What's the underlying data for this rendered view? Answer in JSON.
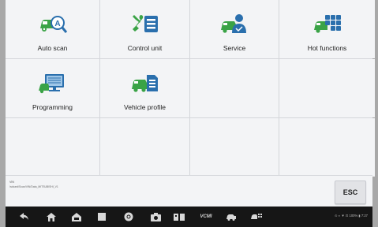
{
  "tiles": [
    {
      "label": "Auto scan"
    },
    {
      "label": "Control unit"
    },
    {
      "label": "Service"
    },
    {
      "label": "Hot functions"
    },
    {
      "label": "Programming"
    },
    {
      "label": "Vehicle profile"
    }
  ],
  "footer": {
    "vin_label": "VIN",
    "vin_path": "/sdcard/Scan/VIN/Data_MITSUBISHI_V1",
    "esc_label": "ESC"
  },
  "navbar": {
    "status_text": "⊙ ◐ ▼ ⊡ 100% ▮ 7:27",
    "vcm_label": "VCMI"
  },
  "colors": {
    "icon_primary": "#2a6fad",
    "icon_secondary": "#3aa346",
    "navbar_bg": "#161616"
  }
}
